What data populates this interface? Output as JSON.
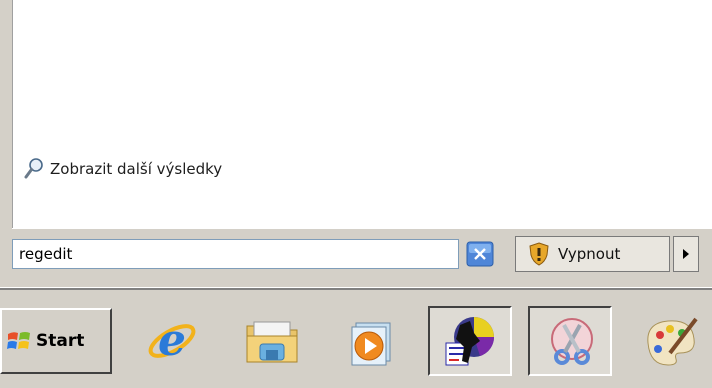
{
  "start_menu": {
    "more_results": "Zobrazit další výsledky",
    "search_value": "regedit",
    "shutdown_label": "Vypnout"
  },
  "taskbar": {
    "start_label": "Start",
    "icons": [
      "internet-explorer-icon",
      "file-explorer-icon",
      "media-player-icon",
      "game-icon",
      "snipping-tool-icon",
      "paint-icon"
    ]
  },
  "colors": {
    "chrome": "#d4d0c8",
    "accent_blue": "#3a7bd5"
  }
}
